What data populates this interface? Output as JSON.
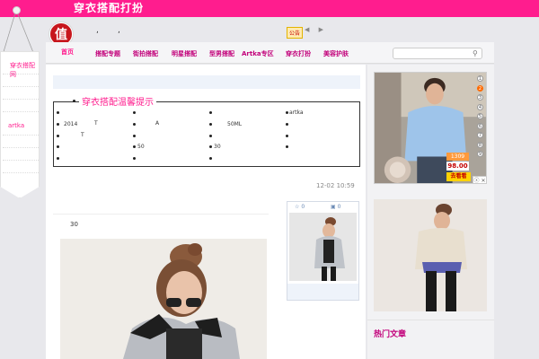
{
  "site": {
    "banner_title": "穿衣搭配打扮",
    "avatar_text": "值",
    "notice_label": "公告",
    "notice_arrows": "◀ ▶"
  },
  "side_tag": {
    "item1": "穿衣搭配网",
    "item2": "artka"
  },
  "nav": {
    "items": [
      "首页",
      "搭配专题",
      "街拍搭配",
      "明星搭配",
      "型男搭配",
      "Artka专区",
      "穿衣打扮",
      "美容护肤"
    ]
  },
  "feature_box": {
    "title": "穿衣搭配温馨提示",
    "cells": [
      "2014",
      "T",
      "A",
      "50ML",
      "artka",
      "T",
      "50",
      "30"
    ]
  },
  "post": {
    "time": "12-02 10:59",
    "number": "30"
  },
  "small_card": {
    "likes": "0",
    "comments": "0"
  },
  "ad": {
    "numbers": [
      "1",
      "2",
      "3",
      "4",
      "5",
      "6",
      "7",
      "8",
      "9"
    ],
    "active_index": 1,
    "price_old": "1309",
    "price_new": "98.00",
    "buy_label": "去看看",
    "close_label": "ⓧ ✕"
  },
  "sidebar": {
    "section_title": "热门文章"
  },
  "colors": {
    "brand": "#ff1d8e",
    "nav_text": "#c2007a"
  }
}
